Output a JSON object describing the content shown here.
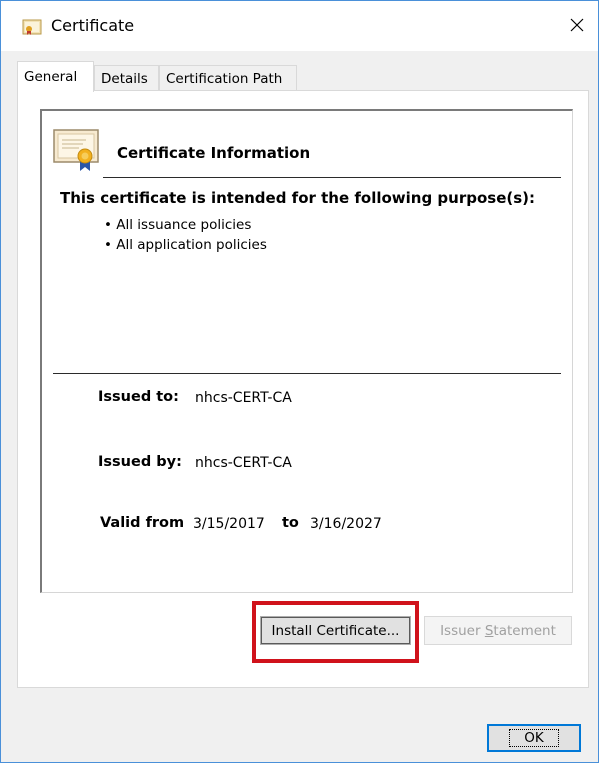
{
  "window": {
    "title": "Certificate",
    "close_label": "×",
    "icon": "certificate-icon"
  },
  "tabs": [
    {
      "label": "General",
      "active": true
    },
    {
      "label": "Details",
      "active": false
    },
    {
      "label": "Certification Path",
      "active": false
    }
  ],
  "info": {
    "title": "Certificate Information",
    "purpose_heading": "This certificate is intended for the following purpose(s):",
    "policies": [
      "• All issuance policies",
      "• All application policies"
    ]
  },
  "fields": {
    "issued_to_label": "Issued to:",
    "issued_to_value": "nhcs-CERT-CA",
    "issued_by_label": "Issued by:",
    "issued_by_value": "nhcs-CERT-CA",
    "valid_from_label": "Valid from",
    "valid_from_value": "3/15/2017",
    "to_label": "to",
    "valid_to_value": "3/16/2027"
  },
  "buttons": {
    "install_pre": "Install Certificate...",
    "issuer_pre": "Issuer ",
    "issuer_u": "S",
    "issuer_post": "tatement",
    "ok": "OK"
  },
  "colors": {
    "highlight": "#d0121b",
    "focus_border": "#0078d7",
    "window_border": "#4a90d9"
  }
}
